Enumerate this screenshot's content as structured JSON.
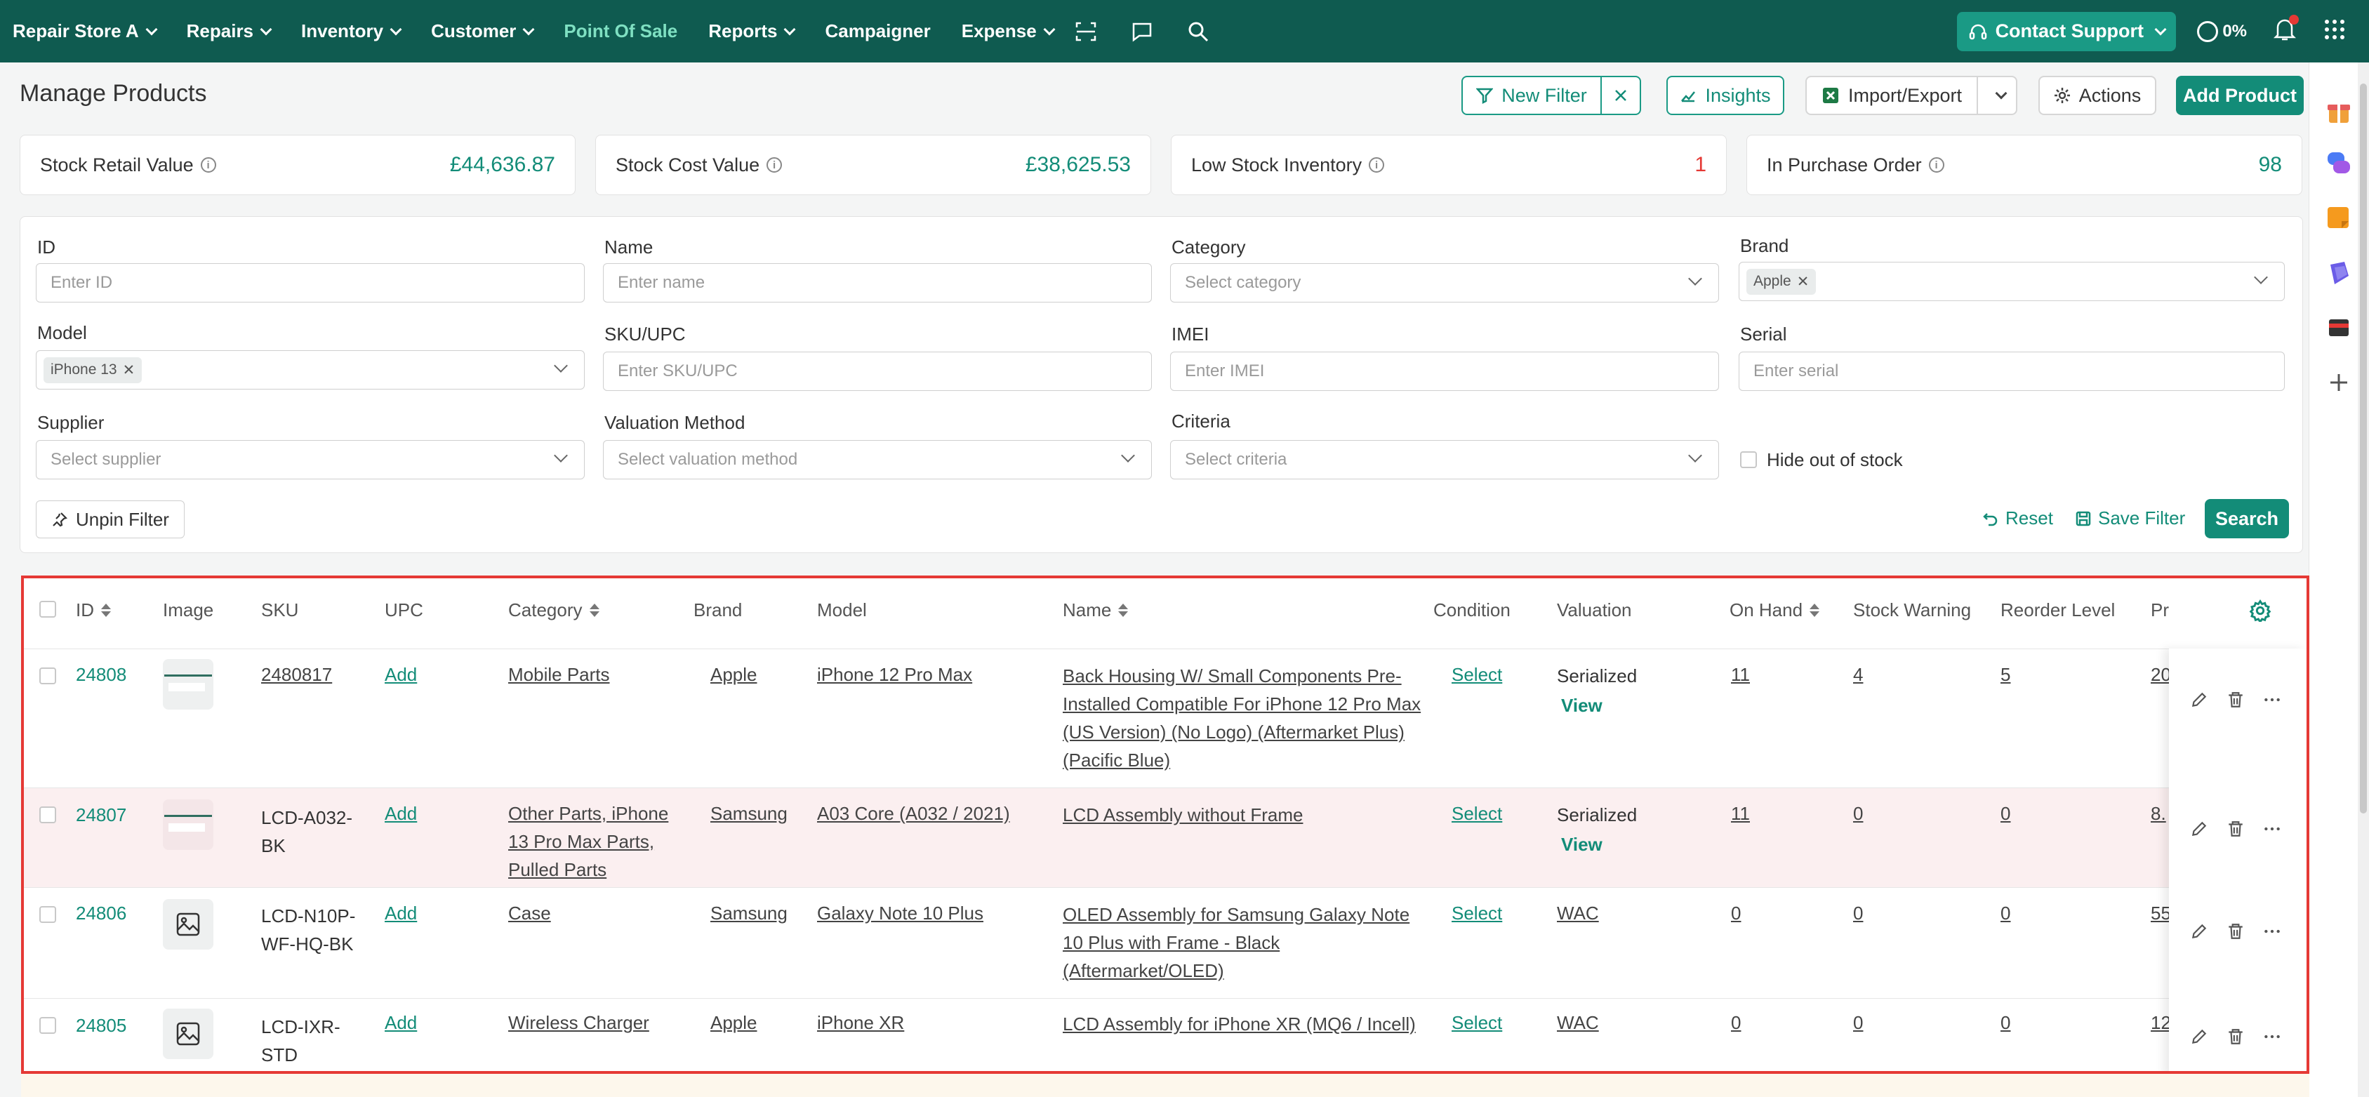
{
  "nav": {
    "store": "Repair Store A",
    "items": [
      "Repairs",
      "Inventory",
      "Customer"
    ],
    "point_of_sale": "Point Of Sale",
    "reports": "Reports",
    "campaigner": "Campaigner",
    "expense": "Expense",
    "contact_support": "Contact Support",
    "progress": "0%",
    "accent": "#7fe0c2",
    "bar_color": "#0f5b50"
  },
  "header": {
    "title": "Manage Products",
    "new_filter": "New Filter",
    "insights": "Insights",
    "import_export": "Import/Export",
    "actions": "Actions",
    "add_product": "Add Product"
  },
  "stats": [
    {
      "label": "Stock Retail Value",
      "value": "£44,636.87"
    },
    {
      "label": "Stock Cost Value",
      "value": "£38,625.53"
    },
    {
      "label": "Low Stock Inventory",
      "value": "1"
    },
    {
      "label": "In Purchase Order",
      "value": "98"
    }
  ],
  "filters": {
    "id": {
      "label": "ID",
      "placeholder": "Enter ID"
    },
    "name": {
      "label": "Name",
      "placeholder": "Enter name"
    },
    "category": {
      "label": "Category",
      "placeholder": "Select category"
    },
    "brand": {
      "label": "Brand",
      "chip": "Apple"
    },
    "model": {
      "label": "Model",
      "chip": "iPhone 13"
    },
    "sku": {
      "label": "SKU/UPC",
      "placeholder": "Enter SKU/UPC"
    },
    "imei": {
      "label": "IMEI",
      "placeholder": "Enter IMEI"
    },
    "serial": {
      "label": "Serial",
      "placeholder": "Enter serial"
    },
    "supplier": {
      "label": "Supplier",
      "placeholder": "Select supplier"
    },
    "valuation": {
      "label": "Valuation Method",
      "placeholder": "Select valuation method"
    },
    "criteria": {
      "label": "Criteria",
      "placeholder": "Select criteria"
    },
    "hide_out_of_stock": "Hide out of stock",
    "unpin": "Unpin Filter",
    "reset": "Reset",
    "save": "Save Filter",
    "search": "Search"
  },
  "table": {
    "headers": {
      "id": "ID",
      "image": "Image",
      "sku": "SKU",
      "upc": "UPC",
      "category": "Category",
      "brand": "Brand",
      "model": "Model",
      "name": "Name",
      "condition": "Condition",
      "valuation": "Valuation",
      "on_hand": "On Hand",
      "stock_warning": "Stock Warning",
      "reorder_level": "Reorder Level",
      "price": "Pr"
    },
    "rows": [
      {
        "id": "24808",
        "sku": "2480817",
        "upc": "Add",
        "category": "Mobile Parts",
        "brand": "Apple",
        "model": "iPhone 12 Pro Max",
        "name": "Back Housing W/ Small Components Pre-Installed Compatible For iPhone 12 Pro Max (US Version) (No Logo) (Aftermarket Plus) (Pacific Blue)",
        "condition": "Select",
        "valuation": "Serialized",
        "valuation_link": "View",
        "on_hand": "11",
        "stock_warning": "4",
        "reorder_level": "5",
        "price": "20"
      },
      {
        "id": "24807",
        "sku": "LCD-A032-BK",
        "upc": "Add",
        "category": "Other Parts, iPhone 13 Pro Max Parts, Pulled Parts",
        "brand": "Samsung",
        "model": "A03 Core (A032 / 2021)",
        "name": "LCD Assembly without Frame",
        "condition": "Select",
        "valuation": "Serialized",
        "valuation_link": "View",
        "on_hand": "11",
        "stock_warning": "0",
        "reorder_level": "0",
        "price": "8."
      },
      {
        "id": "24806",
        "sku": "LCD-N10P-WF-HQ-BK",
        "upc": "Add",
        "category": "Case",
        "brand": "Samsung",
        "model": "Galaxy Note 10 Plus",
        "name": "OLED Assembly for Samsung Galaxy Note 10 Plus with Frame - Black (Aftermarket/OLED)",
        "condition": "Select",
        "valuation": "WAC",
        "valuation_link": "",
        "on_hand": "0",
        "stock_warning": "0",
        "reorder_level": "0",
        "price": "55"
      },
      {
        "id": "24805",
        "sku": "LCD-IXR-STD",
        "upc": "Add",
        "category": "Wireless Charger",
        "brand": "Apple",
        "model": "iPhone XR",
        "name": "LCD Assembly for iPhone XR (MQ6 / Incell)",
        "condition": "Select",
        "valuation": "WAC",
        "valuation_link": "",
        "on_hand": "0",
        "stock_warning": "0",
        "reorder_level": "0",
        "price": "12"
      }
    ]
  }
}
